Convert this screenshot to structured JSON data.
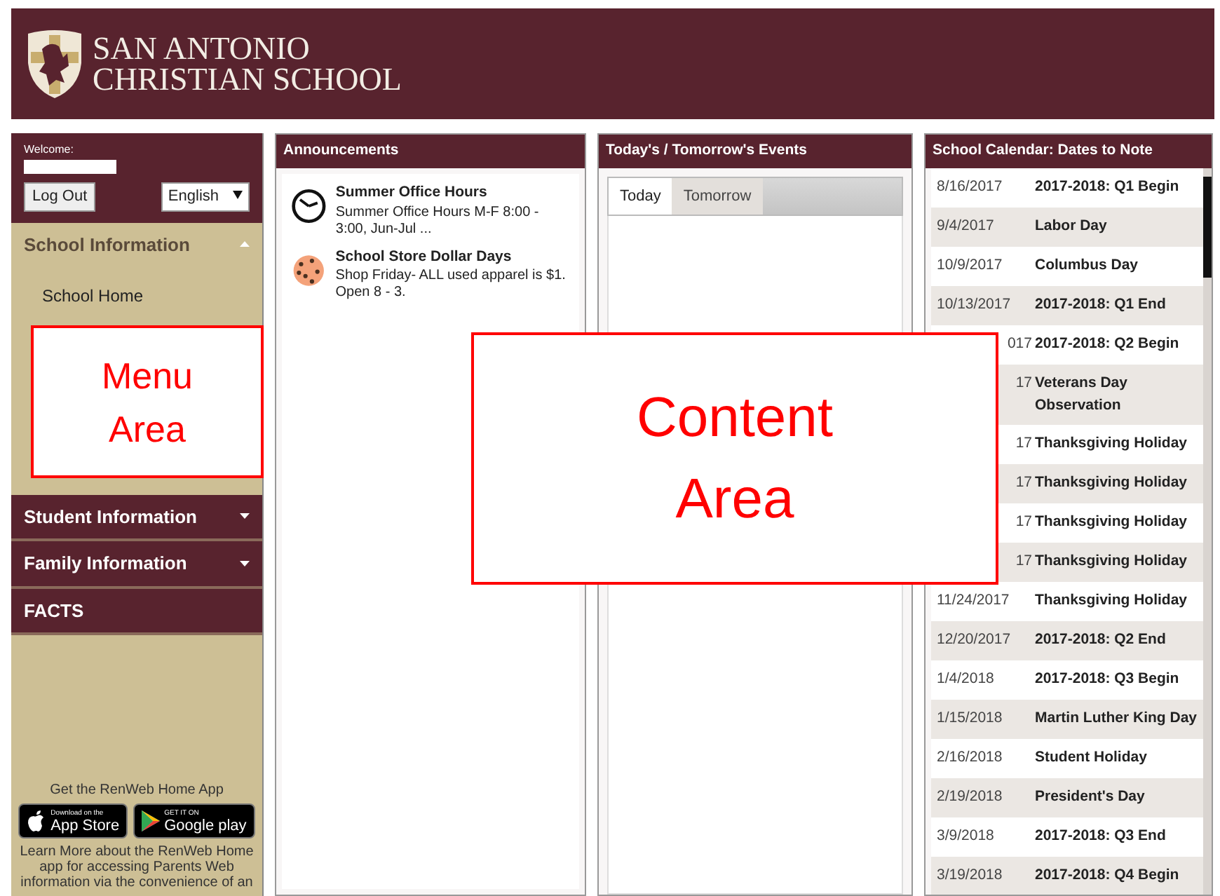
{
  "header": {
    "school_name": [
      "SAN ANTONIO",
      "CHRISTIAN SCHOOL"
    ]
  },
  "sidebar": {
    "welcome": "Welcome:",
    "logout": "Log Out",
    "language": "English",
    "menu": [
      {
        "kind": "group",
        "label": "School Information",
        "expanded": true,
        "children": [
          {
            "label": "School Home"
          }
        ]
      },
      {
        "kind": "group",
        "label": "Student Information",
        "expanded": false
      },
      {
        "kind": "group",
        "label": "Family Information",
        "expanded": false
      },
      {
        "kind": "link",
        "label": "FACTS"
      }
    ],
    "app_promo": {
      "title": "Get the RenWeb Home App",
      "app_store": {
        "small": "Download on the",
        "big": "App Store"
      },
      "google_play": {
        "small": "GET IT ON",
        "big": "Google play"
      },
      "link": "Learn More",
      "text": " about the RenWeb Home app for accessing Parents Web information via the convenience of an"
    }
  },
  "announcements": {
    "title": "Announcements",
    "items": [
      {
        "kind": "clock",
        "title": "Summer Office Hours",
        "text": "Summer Office Hours M-F 8:00 - 3:00, Jun-Jul ..."
      },
      {
        "kind": "cookie",
        "title": "School Store Dollar Days",
        "text": "Shop Friday- ALL used apparel is $1. Open 8 - 3."
      }
    ]
  },
  "events": {
    "title": "Today's / Tomorrow's Events",
    "tabs": [
      {
        "label": "Today",
        "selected": true
      },
      {
        "label": "Tomorrow",
        "selected": false
      }
    ]
  },
  "calendar": {
    "title": "School Calendar: Dates to Note",
    "rows": [
      {
        "date": "8/16/2017",
        "event": "2017-2018: Q1 Begin"
      },
      {
        "date": "9/4/2017",
        "event": "Labor Day"
      },
      {
        "date": "10/9/2017",
        "event": "Columbus Day"
      },
      {
        "date": "10/13/2017",
        "event": "2017-2018: Q1 End"
      },
      {
        "date": "017",
        "partial": true,
        "event": "2017-2018: Q2 Begin"
      },
      {
        "date": "17",
        "partial": true,
        "event": "Veterans Day Observation"
      },
      {
        "date": "17",
        "partial": true,
        "event": "Thanksgiving Holiday"
      },
      {
        "date": "17",
        "partial": true,
        "event": "Thanksgiving Holiday"
      },
      {
        "date": "17",
        "partial": true,
        "event": "Thanksgiving Holiday"
      },
      {
        "date": "17",
        "partial": true,
        "event": "Thanksgiving Holiday"
      },
      {
        "date": "11/24/2017",
        "event": "Thanksgiving Holiday"
      },
      {
        "date": "12/20/2017",
        "event": "2017-2018: Q2 End"
      },
      {
        "date": "1/4/2018",
        "event": "2017-2018: Q3 Begin"
      },
      {
        "date": "1/15/2018",
        "event": "Martin Luther King Day"
      },
      {
        "date": "2/16/2018",
        "event": "Student Holiday"
      },
      {
        "date": "2/19/2018",
        "event": "President's Day"
      },
      {
        "date": "3/9/2018",
        "event": "2017-2018: Q3 End"
      },
      {
        "date": "3/19/2018",
        "event": "2017-2018: Q4 Begin"
      }
    ]
  },
  "annotations": [
    {
      "kind": "menu",
      "lines": [
        "Menu",
        "Area"
      ]
    },
    {
      "kind": "content",
      "lines": [
        "Content",
        "Area"
      ]
    }
  ]
}
